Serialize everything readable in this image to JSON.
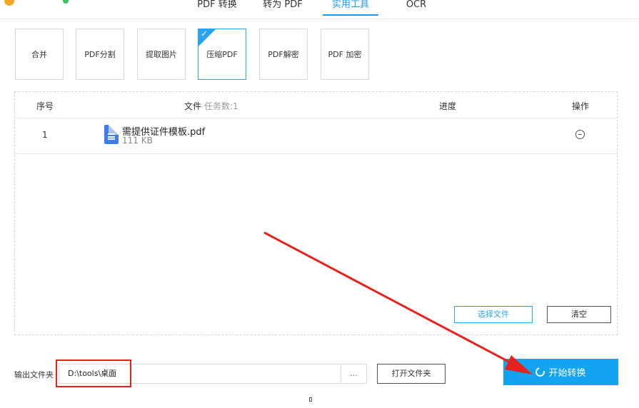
{
  "nav": {
    "tabs": [
      {
        "label": "PDF 转换"
      },
      {
        "label": "转为 PDF"
      },
      {
        "label": "实用工具"
      },
      {
        "label": "OCR"
      }
    ]
  },
  "tools": [
    {
      "label": "合并"
    },
    {
      "label": "PDF分割"
    },
    {
      "label": "提取图片"
    },
    {
      "label": "压缩PDF"
    },
    {
      "label": "PDF解密"
    },
    {
      "label": "PDF 加密"
    }
  ],
  "table": {
    "col_index": "序号",
    "col_file": "文件",
    "col_task_count": "任务数:1",
    "col_progress": "进度",
    "col_action": "操作",
    "rows": [
      {
        "index": "1",
        "name": "需提供证件模板.pdf",
        "size": "111 KB"
      }
    ]
  },
  "buttons": {
    "select_file": "选择文件",
    "clear": "清空",
    "browse": "...",
    "open_folder": "打开文件夹",
    "start": "开始转换"
  },
  "output": {
    "label": "输出文件夹",
    "path": "D:\\tools\\桌面"
  },
  "colors": {
    "accent": "#12a4f0",
    "annotation": "#e8211d"
  }
}
